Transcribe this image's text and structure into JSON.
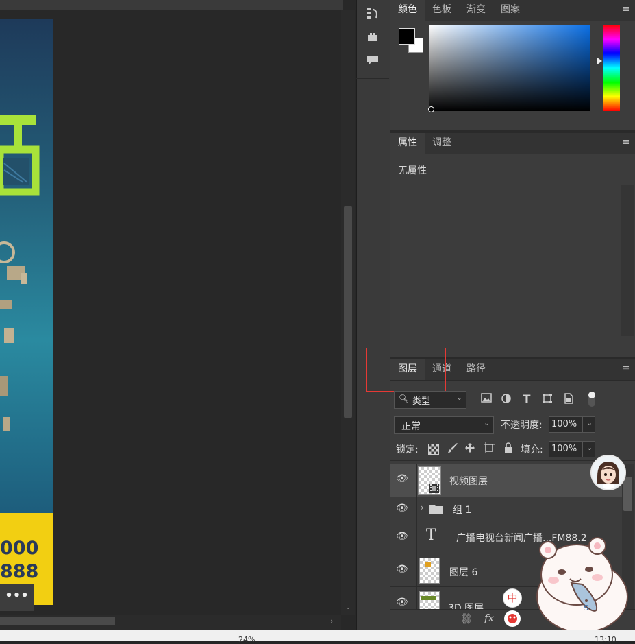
{
  "colors": {
    "accent_red": "#e53935",
    "poster_yellow": "#f2cf12",
    "poster_text_green": "#a8e23a"
  },
  "canvas": {
    "phone_line_1": "000",
    "phone_line_2": "888",
    "more_button": "•••"
  },
  "color_panel": {
    "tabs": [
      "颜色",
      "色板",
      "渐变",
      "图案"
    ]
  },
  "properties_panel": {
    "tabs": [
      "属性",
      "调整"
    ],
    "empty_text": "无属性"
  },
  "layers_panel": {
    "tabs": [
      "图层",
      "通道",
      "路径"
    ],
    "filter_label": "类型",
    "blend_mode": "正常",
    "opacity_label": "不透明度:",
    "opacity_value": "100%",
    "lock_label": "锁定:",
    "fill_label": "填充:",
    "fill_value": "100%",
    "layers": [
      {
        "name": "视频图层",
        "type": "video",
        "selected": true
      },
      {
        "name": "组 1",
        "type": "group"
      },
      {
        "name": "广播电视台新闻广播...FM88.2",
        "type": "text"
      },
      {
        "name": "图层 6",
        "type": "pixel"
      },
      {
        "name": "3D 图层",
        "type": "3d"
      }
    ],
    "bottom_fx": "fx",
    "ime_label": "中"
  },
  "status_bar": {
    "zoom": "24%",
    "time": "13:10"
  },
  "icons": [
    "history-icon",
    "plugin-icon",
    "comment-icon",
    "eye-icon",
    "folder-icon",
    "text-layer-icon",
    "image-filter-icon",
    "adjust-filter-icon",
    "type-filter-icon",
    "shape-filter-icon",
    "smart-filter-icon",
    "link-icon",
    "fx-icon",
    "menu-icon"
  ]
}
